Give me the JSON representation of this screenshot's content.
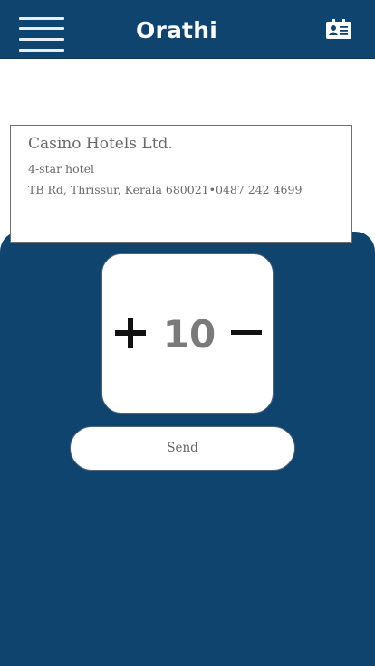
{
  "header": {
    "title": "Orathi",
    "menu_icon": "hamburger-menu-icon",
    "contact_icon": "contact-card-icon",
    "background_color": "#0f446e"
  },
  "hotel": {
    "name": "Casino Hotels Ltd.",
    "type": "4-star hotel",
    "address": "TB Rd, Thrissur, Kerala 680021•0487 242 4699"
  },
  "counter": {
    "plus_icon": "plus-icon",
    "value": "10",
    "minus_icon": "minus-icon"
  },
  "actions": {
    "send_label": "Send"
  },
  "colors": {
    "primary": "#0f446e",
    "text_muted": "#6a6a6a",
    "counter_text": "#7a7a7a"
  }
}
